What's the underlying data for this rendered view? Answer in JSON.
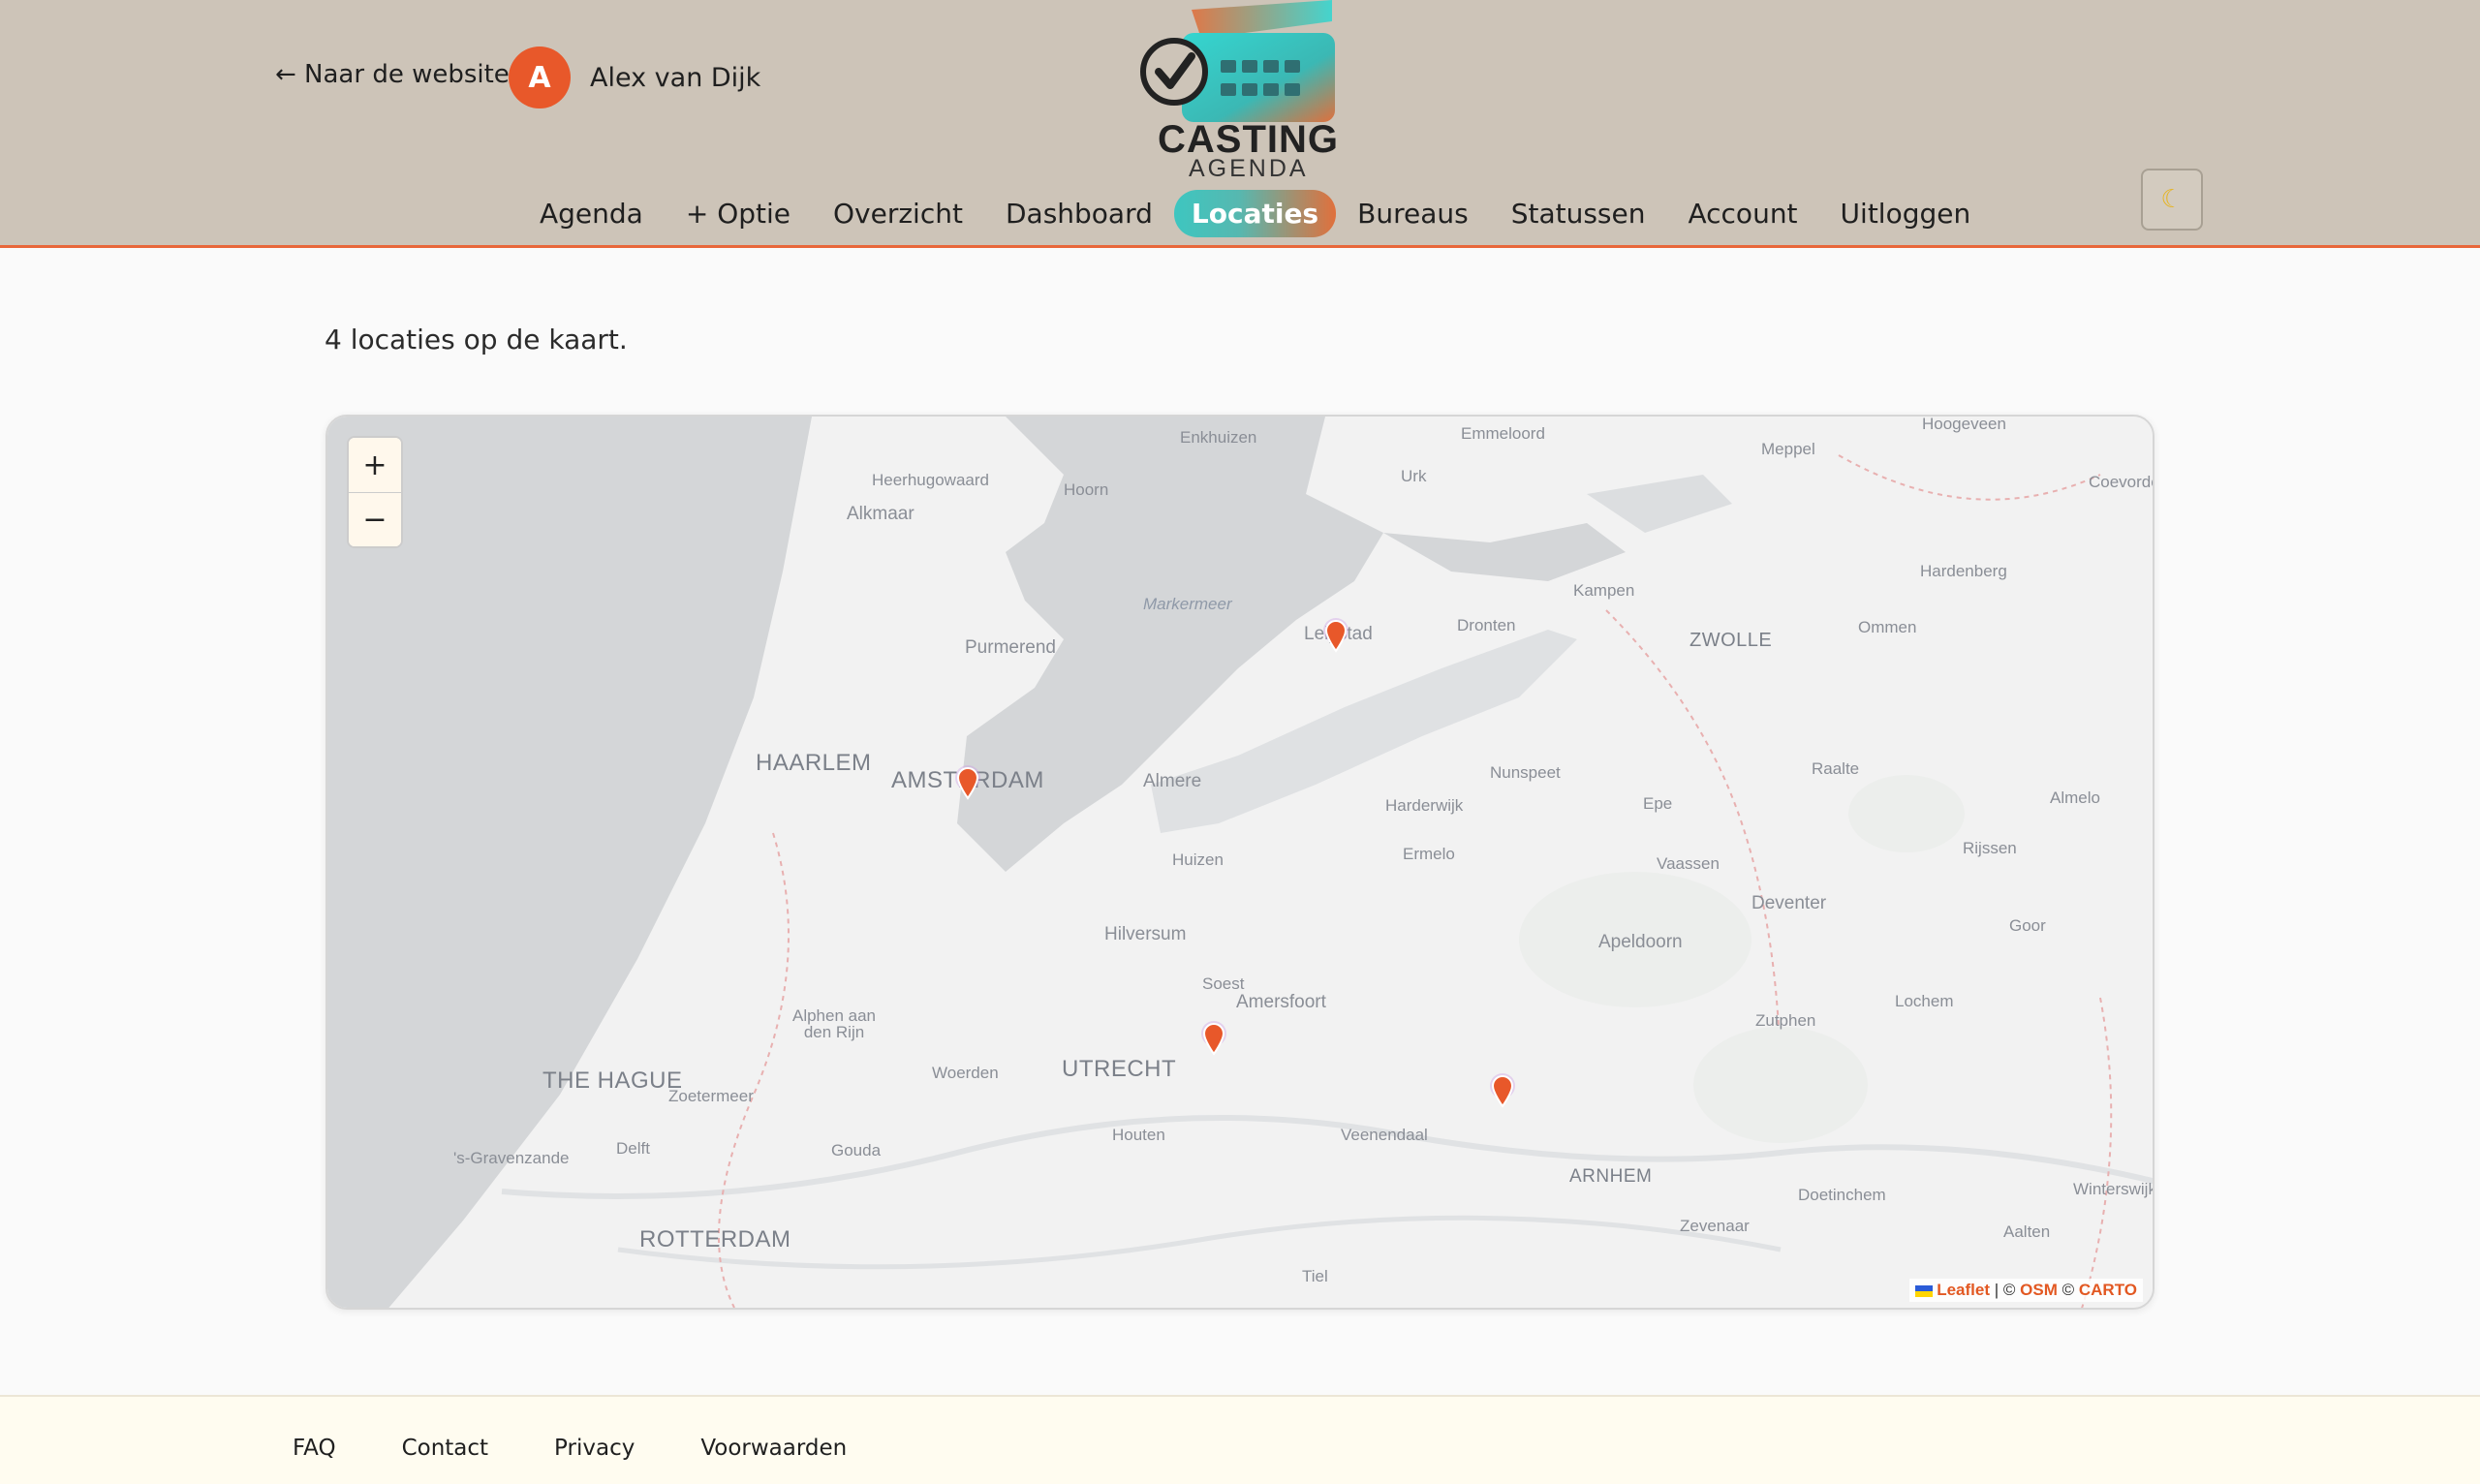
{
  "header": {
    "back_link": "← Naar de website",
    "user": {
      "initial": "A",
      "name": "Alex van Dijk"
    },
    "logo": {
      "line1": "CASTING",
      "line2": "AGENDA"
    },
    "theme_toggle_icon": "moon-icon",
    "nav": [
      {
        "label": "Agenda",
        "active": false
      },
      {
        "label": "+ Optie",
        "active": false
      },
      {
        "label": "Overzicht",
        "active": false
      },
      {
        "label": "Dashboard",
        "active": false
      },
      {
        "label": "Locaties",
        "active": true
      },
      {
        "label": "Bureaus",
        "active": false
      },
      {
        "label": "Statussen",
        "active": false
      },
      {
        "label": "Account",
        "active": false
      },
      {
        "label": "Uitloggen",
        "active": false
      }
    ]
  },
  "main": {
    "summary": "4 locaties op de kaart."
  },
  "map": {
    "zoom_in": "+",
    "zoom_out": "−",
    "attribution": {
      "leaflet": "Leaflet",
      "sep1": " | © ",
      "osm": "OSM",
      "sep2": " © ",
      "carto": "CARTO"
    },
    "cities": [
      "Enkhuizen",
      "Emmeloord",
      "Hoogeveen",
      "Heerhugowaard",
      "Urk",
      "Meppel",
      "Coevorden",
      "Hoorn",
      "Alkmaar",
      "Hardenberg",
      "Markermeer",
      "Kampen",
      "Lelystad",
      "Dronten",
      "Ommen",
      "Purmerend",
      "ZWOLLE",
      "HAARLEM",
      "AMSTERDAM",
      "Almere",
      "Nunspeet",
      "Raalte",
      "Harderwijk",
      "Epe",
      "Almelo",
      "Huizen",
      "Ermelo",
      "Vaassen",
      "Rijssen",
      "Deventer",
      "Goor",
      "Hilversum",
      "Apeldoorn",
      "Soest",
      "Amersfoort",
      "Lochem",
      "Alphen aan den Rijn",
      "Zutphen",
      "THE HAGUE",
      "UTRECHT",
      "Woerden",
      "Zoetermeer",
      "Houten",
      "Veenendaal",
      "Delft",
      "Gouda",
      "'s-Gravenzande",
      "ARNHEM",
      "Doetinchem",
      "Winterswijk",
      "ROTTERDAM",
      "Zevenaar",
      "Aalten",
      "Tiel"
    ]
  },
  "footer": {
    "links": [
      "FAQ",
      "Contact",
      "Privacy",
      "Voorwaarden"
    ]
  }
}
